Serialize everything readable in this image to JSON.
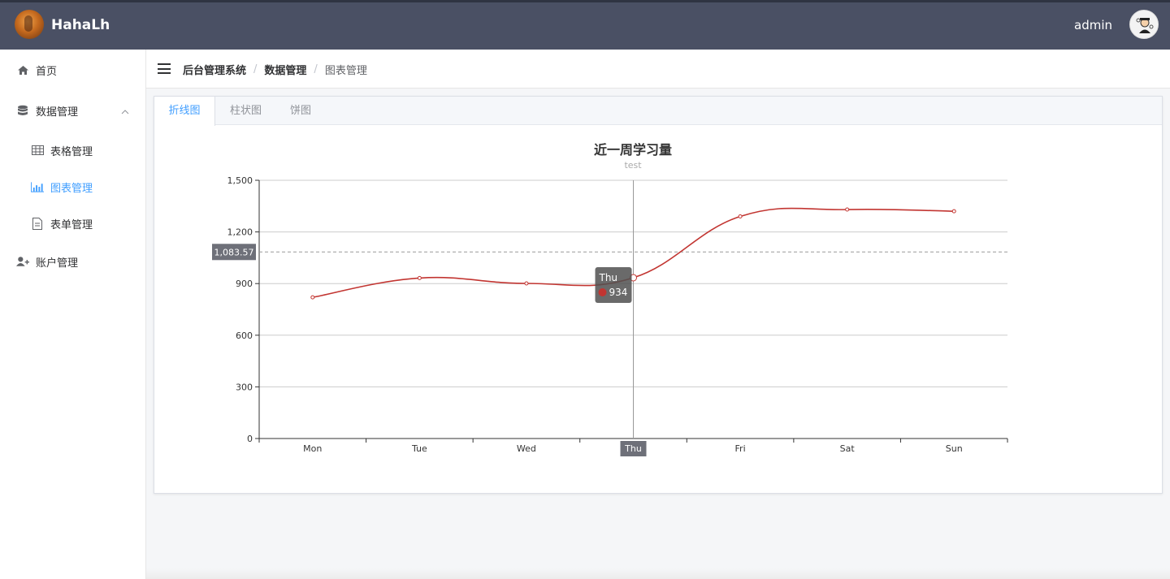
{
  "app": {
    "title": "HahaLh",
    "user": "admin"
  },
  "sidebar": {
    "items": [
      {
        "label": "首页",
        "icon": "home-icon"
      },
      {
        "label": "数据管理",
        "icon": "database-icon",
        "expanded": true
      },
      {
        "label": "表格管理",
        "icon": "table-icon"
      },
      {
        "label": "图表管理",
        "icon": "bar-chart-icon",
        "active": true
      },
      {
        "label": "表单管理",
        "icon": "document-icon"
      },
      {
        "label": "账户管理",
        "icon": "user-add-icon"
      }
    ]
  },
  "breadcrumb": [
    "后台管理系统",
    "数据管理",
    "图表管理"
  ],
  "tabs": [
    "折线图",
    "柱状图",
    "饼图"
  ],
  "chart_data": {
    "type": "line",
    "title": "近一周学习量",
    "subtitle": "test",
    "categories": [
      "Mon",
      "Tue",
      "Wed",
      "Thu",
      "Fri",
      "Sat",
      "Sun"
    ],
    "series": [
      {
        "values": [
          820,
          932,
          901,
          934,
          1290,
          1330,
          1320
        ],
        "color": "#c23531"
      }
    ],
    "ylim": [
      0,
      1500
    ],
    "yticks": [
      "0",
      "300",
      "600",
      "900",
      "1,200",
      "1,500"
    ],
    "grid": true,
    "crosshair": {
      "x_label": "Thu",
      "y_label": "1,083.57",
      "y_value": 1083.57
    },
    "tooltip": {
      "title": "Thu",
      "value": "934"
    }
  },
  "colors": {
    "accent": "#409eff",
    "topbar": "#4a5064",
    "line": "#c23531"
  }
}
